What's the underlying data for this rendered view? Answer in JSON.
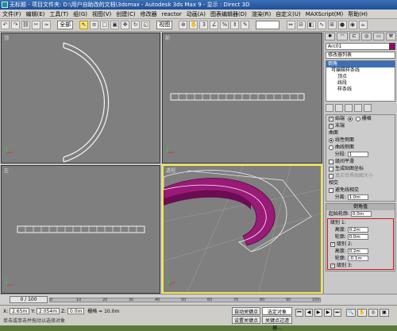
{
  "window": {
    "title": "无标题  - 项目文件夹: D:\\用户自助改的文档\\3dsmax  - Autodesk 3ds Max 9  - 显示 : Direct 3D",
    "title_short": "无标题"
  },
  "menu": [
    "文件(F)",
    "编辑(E)",
    "工具(T)",
    "组(G)",
    "视图(V)",
    "创建(C)",
    "修改器",
    "reactor",
    "动画(A)",
    "图表编辑器(D)",
    "渲染(R)",
    "自定义(U)",
    "MAXScript(M)",
    "帮助(H)"
  ],
  "toolbar": {
    "selection_filter": "全部",
    "ref_coord": "视图"
  },
  "viewports": {
    "top": "顶",
    "front": "前",
    "left": "左",
    "perspective": "透视"
  },
  "command_panel": {
    "object_name": "Arc01",
    "object_color": "#a0006a",
    "modifier_list": "修改器列表",
    "stack": [
      "倒角",
      "可编辑样条线",
      "顶点",
      "线段",
      "样条线"
    ],
    "surface_rollout": {
      "cap_start": "始端",
      "cap_end": "末端",
      "cap_grid": "栅格",
      "curves_title": "曲面",
      "linear_sides": "线性侧面",
      "curved_sides": "曲线侧面",
      "segments_label": "分段:",
      "segments_value": "1",
      "smooth_sides": "级间平滑",
      "gen_mapping": "生成贴图坐标",
      "real_world": "真实世界贴图大小",
      "intersections": "相交",
      "keep_lines": "避免线相交",
      "separation_label": "分离:",
      "separation_value": "1.0m"
    },
    "bevel_values": {
      "title": "倒角值",
      "start_outline_label": "起始轮廓:",
      "start_outline_value": "0.0m",
      "level1": "级别 1:",
      "l1_height_label": "高度:",
      "l1_height_value": "0.2m",
      "l1_outline_label": "轮廓:",
      "l1_outline_value": "0.0m",
      "level2": "级别 2:",
      "l2_height_label": "高度:",
      "l2_height_value": "0.2m",
      "l2_outline_label": "轮廓:",
      "l2_outline_value": "-0.1m",
      "level3": "级别 3:"
    }
  },
  "timeline": {
    "slider": "0 / 100",
    "ticks": [
      "0",
      "10",
      "20",
      "30",
      "40",
      "50",
      "60",
      "70",
      "80",
      "90",
      "100"
    ]
  },
  "status": {
    "x_label": "X:",
    "x_value": "2.65m",
    "y_label": "Y:",
    "y_value": "2.054m",
    "z_label": "Z:",
    "z_value": "0.0m",
    "grid_label": "栅格 = 10.0m",
    "autokey": "自动关键点",
    "selected": "选定对象",
    "setkey": "设置关键点",
    "keyfilters": "关键点过滤器...",
    "prompt": "单击或单击并拖动以选择对象"
  }
}
